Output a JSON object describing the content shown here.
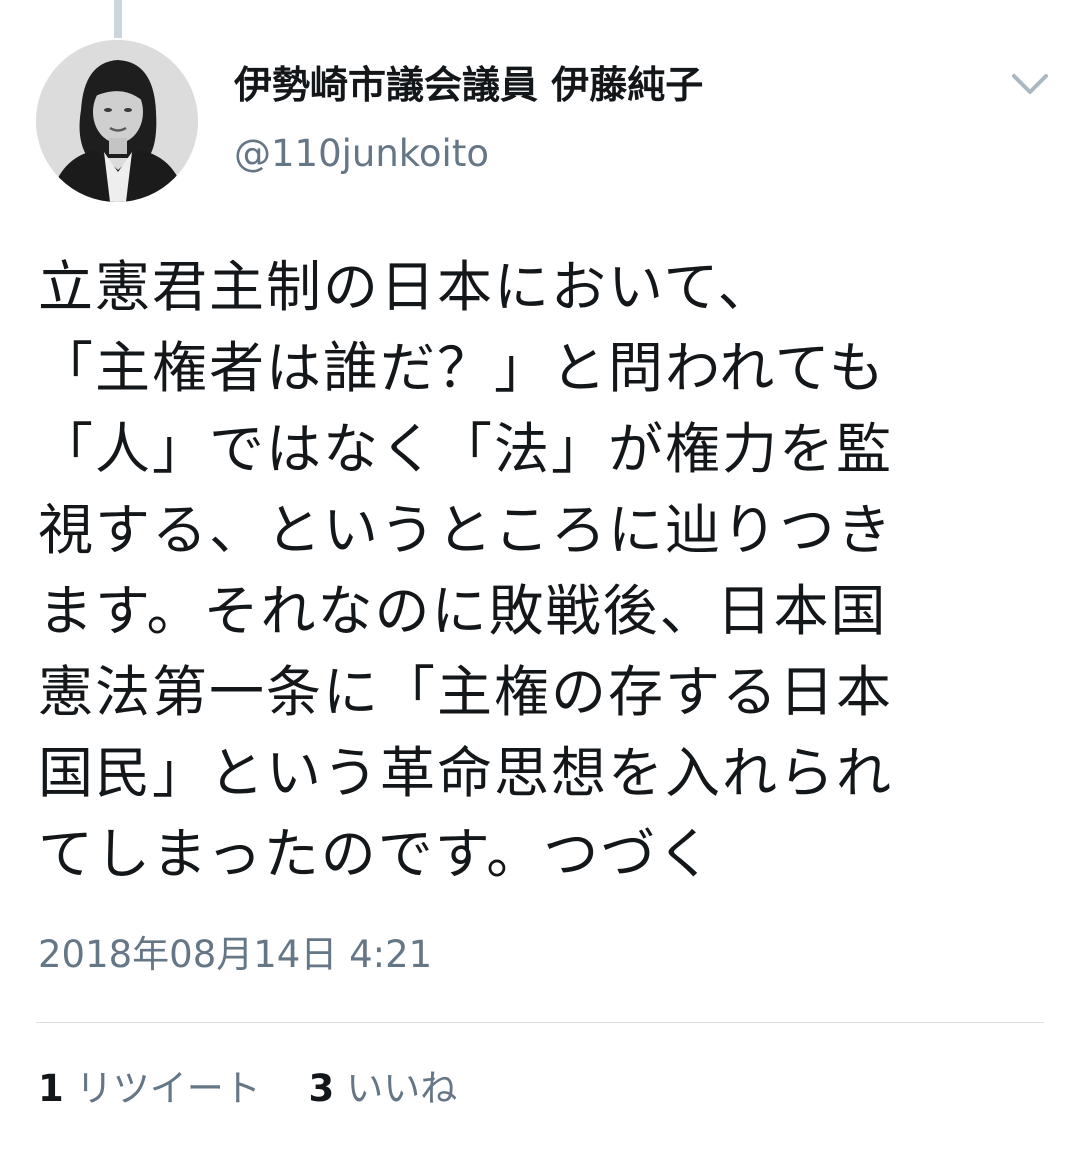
{
  "tweet": {
    "author": {
      "display_name": "伊勢崎市議会議員 伊藤純子",
      "handle": "@110junkoito",
      "avatar_icon": "profile-photo"
    },
    "menu_icon": "chevron-down-icon",
    "text": "立憲君主制の日本において、\n「主権者は誰だ？」と問われても\n「人」ではなく「法」が権力を監\n視する、というところに辿りつき\nます。それなのに敗戦後、日本国\n憲法第一条に「主権の存する日本\n国民」という革命思想を入れられ\nてしまったのです。つづく",
    "timestamp": "2018年08月14日 4:21",
    "stats": {
      "retweets": {
        "count": "1",
        "label": "リツイート"
      },
      "likes": {
        "count": "3",
        "label": "いいね"
      }
    }
  },
  "colors": {
    "text": "#14171a",
    "secondary": "#657786",
    "divider": "#d8dee3",
    "thread_line": "#ccd6dd"
  }
}
